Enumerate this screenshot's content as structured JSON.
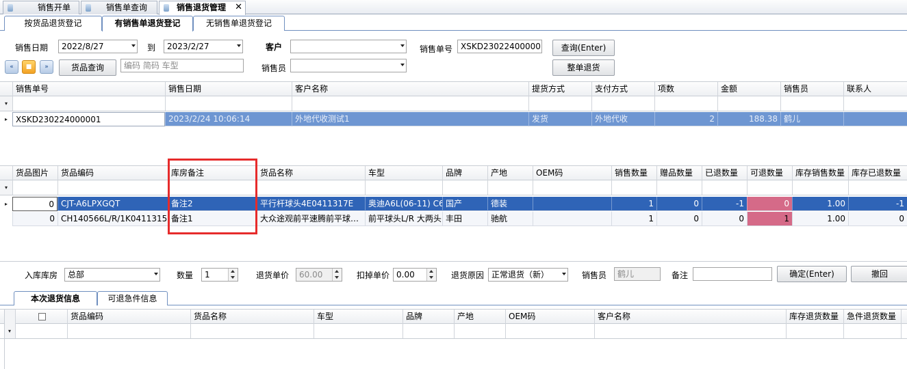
{
  "top_tabs": [
    {
      "label": "销售开单"
    },
    {
      "label": "销售单查询"
    },
    {
      "label": "销售退货管理",
      "close": "✕"
    }
  ],
  "sub_tabs": [
    {
      "label": "按货品退货登记"
    },
    {
      "label": "有销售单退货登记"
    },
    {
      "label": "无销售单退货登记"
    }
  ],
  "filters": {
    "sale_date_label": "销售日期",
    "date_from": "2022/8/27",
    "to_label": "到",
    "date_to": "2023/2/27",
    "customer_label": "客户",
    "customer_value": "",
    "order_no_label": "销售单号",
    "order_no_value": "XSKD230224000001",
    "query_button": "查询(Enter)",
    "whole_return_button": "整单退货",
    "product_query_button": "货品查询",
    "product_search_placeholder": "编码 简码 车型",
    "salesperson_label": "销售员",
    "salesperson_value": ""
  },
  "order_grid": {
    "columns": [
      "销售单号",
      "销售日期",
      "客户名称",
      "提货方式",
      "支付方式",
      "项数",
      "金额",
      "销售员",
      "联系人"
    ],
    "rows": [
      {
        "order_no": "XSKD230224000001",
        "date": "2023/2/24 10:06:14",
        "customer": "外地代收测试1",
        "pickup": "发货",
        "payment": "外地代收",
        "items": "2",
        "amount": "188.38",
        "salesperson": "鹤儿",
        "contact": ""
      }
    ]
  },
  "item_grid": {
    "columns": [
      "货品图片",
      "货品编码",
      "库房备注",
      "货品名称",
      "车型",
      "品牌",
      "产地",
      "OEM码",
      "销售数量",
      "赠品数量",
      "已退数量",
      "可退数量",
      "库存销售数量",
      "库存已退数量"
    ],
    "rows": [
      {
        "image": "0",
        "code": "CJT-A6LPXGQT",
        "remark": "备注2",
        "name": "平行杆球头4E0411317E",
        "model": "奥迪A6L(06-11) C6",
        "brand": "国产",
        "origin": "德装",
        "oem": "",
        "sold": "1",
        "gift": "0",
        "returned": "-1",
        "returnable": "0",
        "stock_sold": "1.00",
        "stock_returned": "-1"
      },
      {
        "image": "0",
        "code": "CH140566L/R/1K0411315",
        "remark": "备注1",
        "name": "大众途观前平速腾前平球…",
        "model": "前平球头L/R 大两头",
        "brand": "丰田",
        "origin": "驰航",
        "oem": "",
        "sold": "1",
        "gift": "0",
        "returned": "0",
        "returnable": "1",
        "stock_sold": "1.00",
        "stock_returned": "0"
      }
    ]
  },
  "return_form": {
    "warehouse_label": "入库库房",
    "warehouse_value": "总部",
    "qty_label": "数量",
    "qty_value": "1",
    "price_label": "退货单价",
    "price_value": "60.00",
    "deduct_label": "扣掉单价",
    "deduct_value": "0.00",
    "reason_label": "退货原因",
    "reason_value": "正常退货（新）",
    "salesperson_label": "销售员",
    "salesperson_value": "鹤儿",
    "note_label": "备注",
    "note_value": "",
    "confirm_button": "确定(Enter)",
    "undo_button": "撤回"
  },
  "bottom_tabs": [
    {
      "label": "本次退货信息"
    },
    {
      "label": "可退急件信息"
    }
  ],
  "return_grid": {
    "columns": [
      "货品编码",
      "货品名称",
      "车型",
      "品牌",
      "产地",
      "OEM码",
      "客户名称",
      "库存退货数量",
      "急件退货数量"
    ]
  },
  "colors": {
    "selected_row": "#2f64b7",
    "order_row": "#6e96d2",
    "returnable_highlight": "#d56a88",
    "annotation_box": "#e62b2b"
  }
}
